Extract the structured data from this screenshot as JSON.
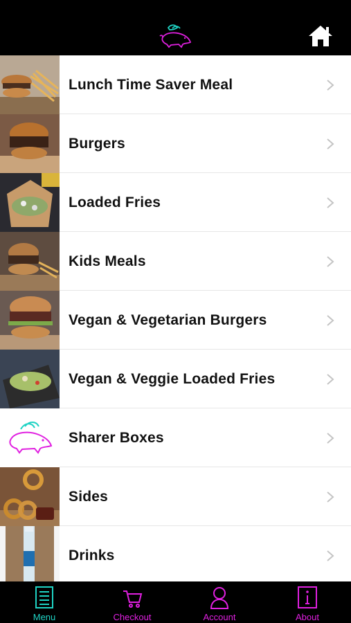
{
  "header": {
    "logo_icon": "pig-logo-icon",
    "home_icon": "home-icon"
  },
  "menu": {
    "items": [
      {
        "label": "Lunch Time Saver Meal",
        "thumb": "burger-fries-photo"
      },
      {
        "label": "Burgers",
        "thumb": "burger-photo"
      },
      {
        "label": "Loaded Fries",
        "thumb": "loaded-fries-photo"
      },
      {
        "label": "Kids Meals",
        "thumb": "kids-meal-photo"
      },
      {
        "label": "Vegan & Vegetarian Burgers",
        "thumb": "vegan-burger-photo"
      },
      {
        "label": "Vegan & Veggie Loaded Fries",
        "thumb": "vegan-fries-photo"
      },
      {
        "label": "Sharer Boxes",
        "thumb": "pig-logo"
      },
      {
        "label": "Sides",
        "thumb": "onion-rings-photo"
      },
      {
        "label": "Drinks",
        "thumb": "water-bottle-photo"
      }
    ]
  },
  "tabs": [
    {
      "label": "Menu",
      "icon": "menu-icon",
      "color": "#1fd3c4",
      "active": true
    },
    {
      "label": "Checkout",
      "icon": "cart-icon",
      "color": "#e020e0"
    },
    {
      "label": "Account",
      "icon": "user-icon",
      "color": "#e020e0"
    },
    {
      "label": "About",
      "icon": "info-icon",
      "color": "#e020e0"
    }
  ],
  "colors": {
    "accent_teal": "#1fd3c4",
    "accent_magenta": "#e020e0",
    "bar_bg": "#000000"
  }
}
